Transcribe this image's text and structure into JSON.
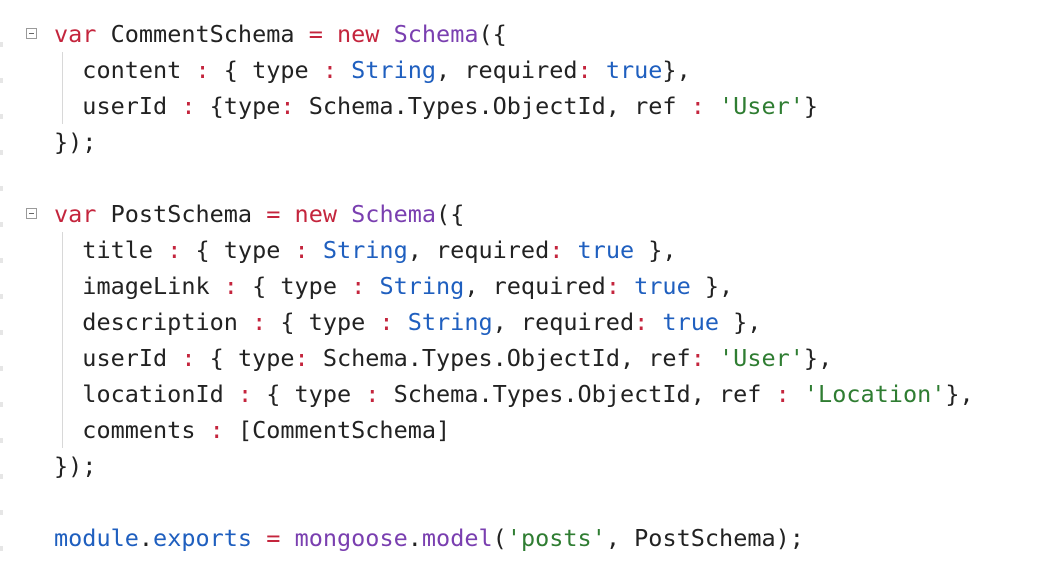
{
  "code": {
    "lines": [
      [
        {
          "t": "var",
          "c": "kw"
        },
        {
          "t": " CommentSchema ",
          "c": "ident"
        },
        {
          "t": "=",
          "c": "op"
        },
        {
          "t": " ",
          "c": "ident"
        },
        {
          "t": "new",
          "c": "kw"
        },
        {
          "t": " ",
          "c": "ident"
        },
        {
          "t": "Schema",
          "c": "cls"
        },
        {
          "t": "({",
          "c": "ident"
        }
      ],
      [
        {
          "t": "  content ",
          "c": "ident"
        },
        {
          "t": ":",
          "c": "op"
        },
        {
          "t": " { type ",
          "c": "ident"
        },
        {
          "t": ":",
          "c": "op"
        },
        {
          "t": " ",
          "c": "ident"
        },
        {
          "t": "String",
          "c": "type"
        },
        {
          "t": ", required",
          "c": "ident"
        },
        {
          "t": ":",
          "c": "op"
        },
        {
          "t": " ",
          "c": "ident"
        },
        {
          "t": "true",
          "c": "bool"
        },
        {
          "t": "},",
          "c": "ident"
        }
      ],
      [
        {
          "t": "  userId ",
          "c": "ident"
        },
        {
          "t": ":",
          "c": "op"
        },
        {
          "t": " {type",
          "c": "ident"
        },
        {
          "t": ":",
          "c": "op"
        },
        {
          "t": " Schema.Types.ObjectId, ref ",
          "c": "ident"
        },
        {
          "t": ":",
          "c": "op"
        },
        {
          "t": " ",
          "c": "ident"
        },
        {
          "t": "'User'",
          "c": "str"
        },
        {
          "t": "}",
          "c": "ident"
        }
      ],
      [
        {
          "t": "});",
          "c": "ident"
        }
      ],
      [],
      [
        {
          "t": "var",
          "c": "kw"
        },
        {
          "t": " PostSchema ",
          "c": "ident"
        },
        {
          "t": "=",
          "c": "op"
        },
        {
          "t": " ",
          "c": "ident"
        },
        {
          "t": "new",
          "c": "kw"
        },
        {
          "t": " ",
          "c": "ident"
        },
        {
          "t": "Schema",
          "c": "cls"
        },
        {
          "t": "({",
          "c": "ident"
        }
      ],
      [
        {
          "t": "  title ",
          "c": "ident"
        },
        {
          "t": ":",
          "c": "op"
        },
        {
          "t": " { type ",
          "c": "ident"
        },
        {
          "t": ":",
          "c": "op"
        },
        {
          "t": " ",
          "c": "ident"
        },
        {
          "t": "String",
          "c": "type"
        },
        {
          "t": ", required",
          "c": "ident"
        },
        {
          "t": ":",
          "c": "op"
        },
        {
          "t": " ",
          "c": "ident"
        },
        {
          "t": "true",
          "c": "bool"
        },
        {
          "t": " },",
          "c": "ident"
        }
      ],
      [
        {
          "t": "  imageLink ",
          "c": "ident"
        },
        {
          "t": ":",
          "c": "op"
        },
        {
          "t": " { type ",
          "c": "ident"
        },
        {
          "t": ":",
          "c": "op"
        },
        {
          "t": " ",
          "c": "ident"
        },
        {
          "t": "String",
          "c": "type"
        },
        {
          "t": ", required",
          "c": "ident"
        },
        {
          "t": ":",
          "c": "op"
        },
        {
          "t": " ",
          "c": "ident"
        },
        {
          "t": "true",
          "c": "bool"
        },
        {
          "t": " },",
          "c": "ident"
        }
      ],
      [
        {
          "t": "  description ",
          "c": "ident"
        },
        {
          "t": ":",
          "c": "op"
        },
        {
          "t": " { type ",
          "c": "ident"
        },
        {
          "t": ":",
          "c": "op"
        },
        {
          "t": " ",
          "c": "ident"
        },
        {
          "t": "String",
          "c": "type"
        },
        {
          "t": ", required",
          "c": "ident"
        },
        {
          "t": ":",
          "c": "op"
        },
        {
          "t": " ",
          "c": "ident"
        },
        {
          "t": "true",
          "c": "bool"
        },
        {
          "t": " },",
          "c": "ident"
        }
      ],
      [
        {
          "t": "  userId ",
          "c": "ident"
        },
        {
          "t": ":",
          "c": "op"
        },
        {
          "t": " { type",
          "c": "ident"
        },
        {
          "t": ":",
          "c": "op"
        },
        {
          "t": " Schema.Types.ObjectId, ref",
          "c": "ident"
        },
        {
          "t": ":",
          "c": "op"
        },
        {
          "t": " ",
          "c": "ident"
        },
        {
          "t": "'User'",
          "c": "str"
        },
        {
          "t": "},",
          "c": "ident"
        }
      ],
      [
        {
          "t": "  locationId ",
          "c": "ident"
        },
        {
          "t": ":",
          "c": "op"
        },
        {
          "t": " { type ",
          "c": "ident"
        },
        {
          "t": ":",
          "c": "op"
        },
        {
          "t": " Schema.Types.ObjectId, ref ",
          "c": "ident"
        },
        {
          "t": ":",
          "c": "op"
        },
        {
          "t": " ",
          "c": "ident"
        },
        {
          "t": "'Location'",
          "c": "str"
        },
        {
          "t": "},",
          "c": "ident"
        }
      ],
      [
        {
          "t": "  comments ",
          "c": "ident"
        },
        {
          "t": ":",
          "c": "op"
        },
        {
          "t": " [CommentSchema]",
          "c": "ident"
        }
      ],
      [
        {
          "t": "});",
          "c": "ident"
        }
      ],
      [],
      [
        {
          "t": "module",
          "c": "mod"
        },
        {
          "t": ".",
          "c": "ident"
        },
        {
          "t": "exports",
          "c": "mod"
        },
        {
          "t": " ",
          "c": "ident"
        },
        {
          "t": "=",
          "c": "op"
        },
        {
          "t": " ",
          "c": "ident"
        },
        {
          "t": "mongoose",
          "c": "fn"
        },
        {
          "t": ".",
          "c": "ident"
        },
        {
          "t": "model",
          "c": "fn"
        },
        {
          "t": "(",
          "c": "ident"
        },
        {
          "t": "'posts'",
          "c": "str"
        },
        {
          "t": ", PostSchema);",
          "c": "ident"
        }
      ]
    ],
    "folds": [
      0,
      5
    ]
  },
  "colors": {
    "keyword": "#c4253d",
    "class": "#7a3fb0",
    "type": "#1f5fbf",
    "string": "#2f7d32",
    "text": "#222222"
  }
}
